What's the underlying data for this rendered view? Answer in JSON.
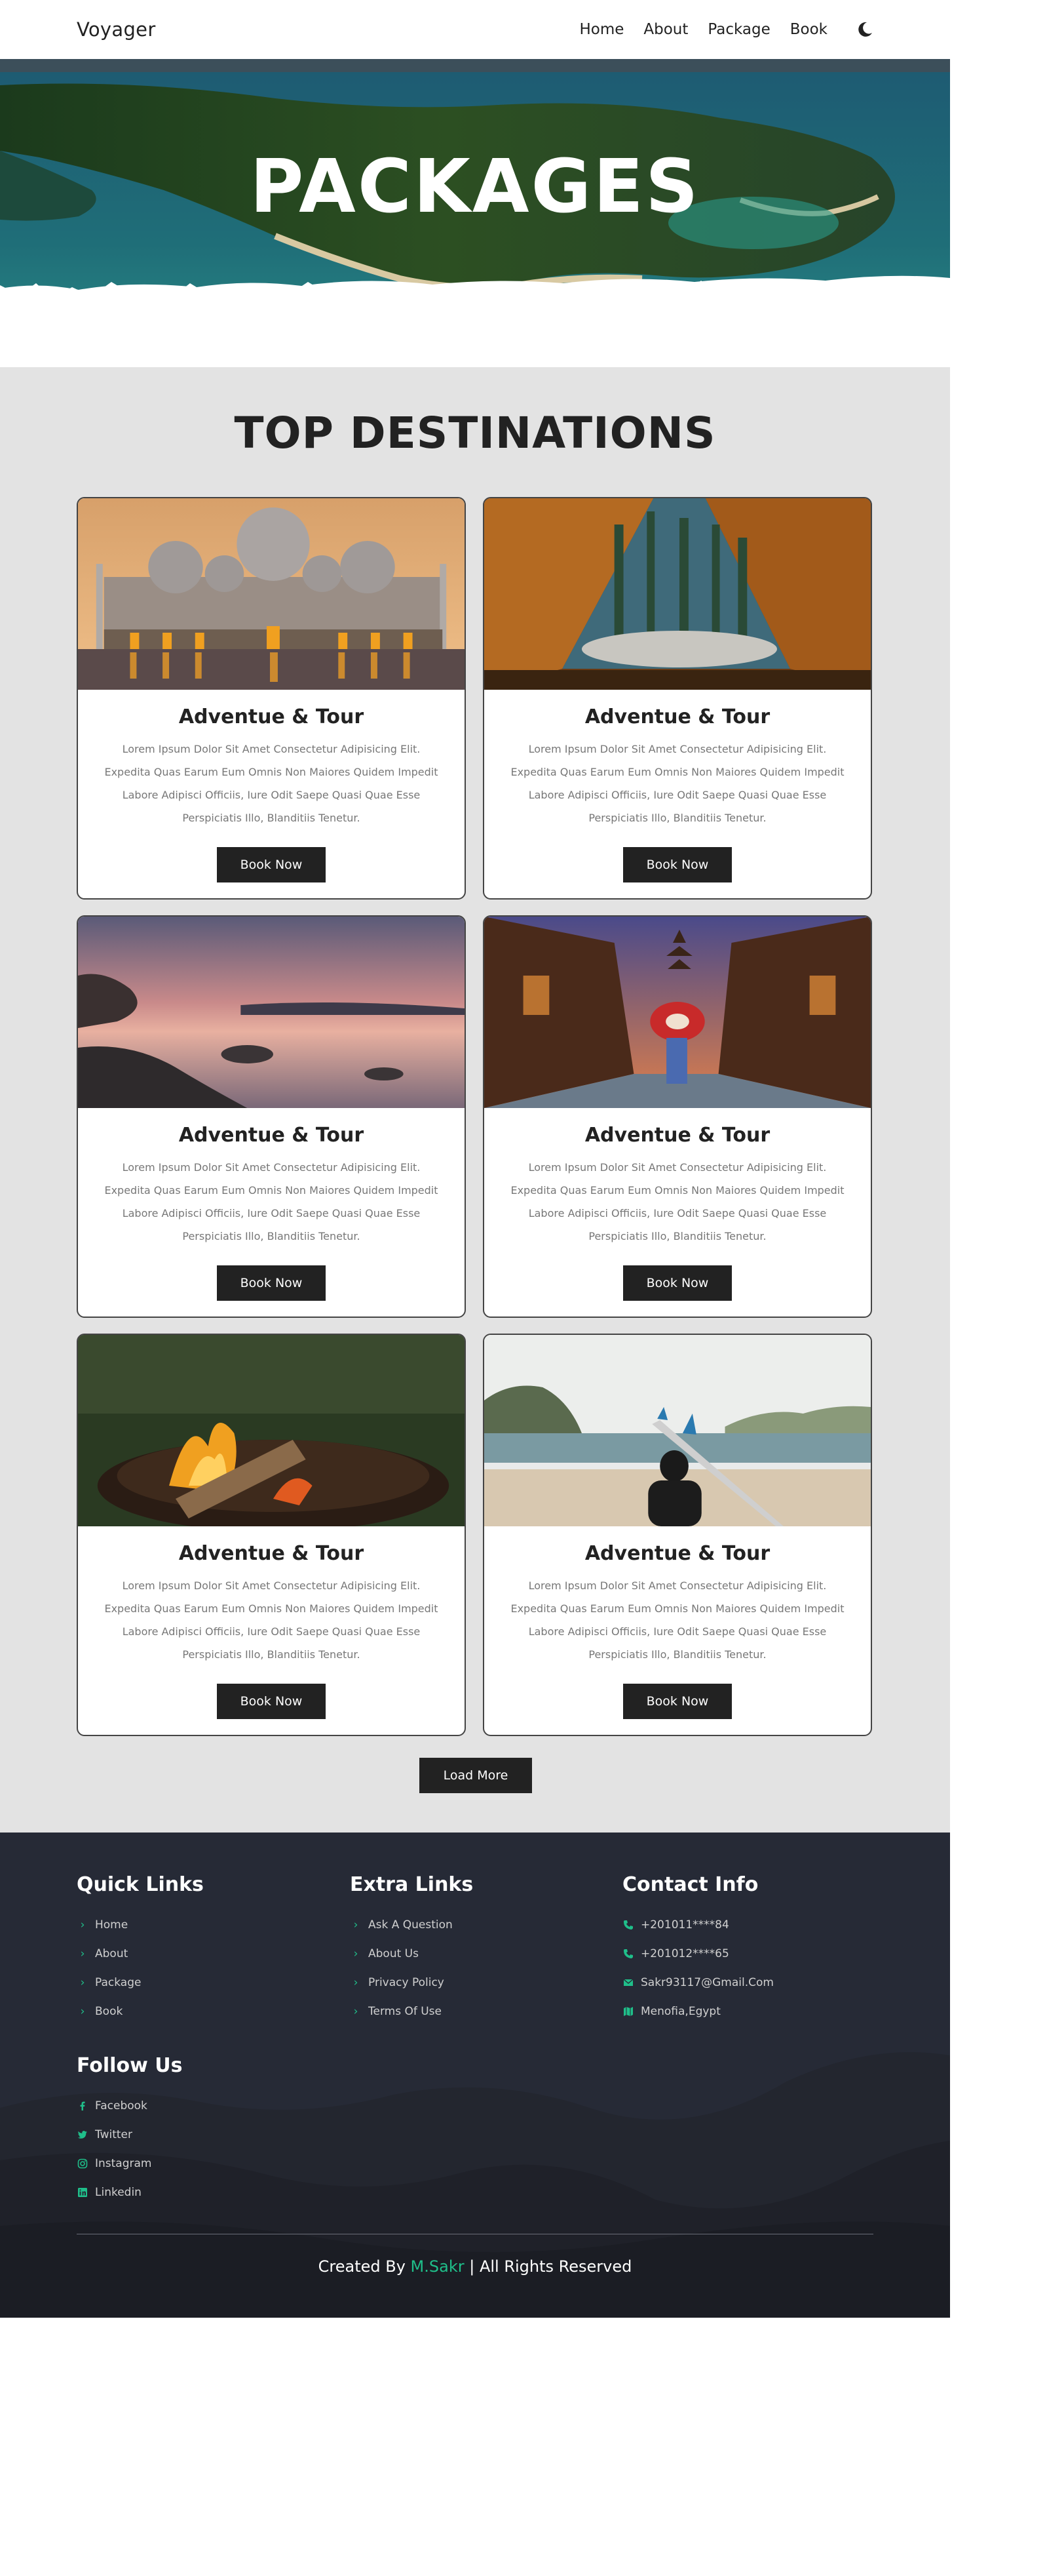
{
  "nav": {
    "logo": "Voyager",
    "links": [
      "Home",
      "About",
      "Package",
      "Book"
    ]
  },
  "hero": {
    "title": "PACKAGES"
  },
  "destinations": {
    "title": "TOP DESTINATIONS",
    "cards": [
      {
        "title": "Adventue & Tour",
        "text": "Lorem Ipsum Dolor Sit Amet Consectetur Adipisicing Elit. Expedita Quas Earum Eum Omnis Non Maiores Quidem Impedit Labore Adipisci Officiis, Iure Odit Saepe Quasi Quae Esse Perspiciatis Illo, Blanditiis Tenetur.",
        "button": "Book Now"
      },
      {
        "title": "Adventue & Tour",
        "text": "Lorem Ipsum Dolor Sit Amet Consectetur Adipisicing Elit. Expedita Quas Earum Eum Omnis Non Maiores Quidem Impedit Labore Adipisci Officiis, Iure Odit Saepe Quasi Quae Esse Perspiciatis Illo, Blanditiis Tenetur.",
        "button": "Book Now"
      },
      {
        "title": "Adventue & Tour",
        "text": "Lorem Ipsum Dolor Sit Amet Consectetur Adipisicing Elit. Expedita Quas Earum Eum Omnis Non Maiores Quidem Impedit Labore Adipisci Officiis, Iure Odit Saepe Quasi Quae Esse Perspiciatis Illo, Blanditiis Tenetur.",
        "button": "Book Now"
      },
      {
        "title": "Adventue & Tour",
        "text": "Lorem Ipsum Dolor Sit Amet Consectetur Adipisicing Elit. Expedita Quas Earum Eum Omnis Non Maiores Quidem Impedit Labore Adipisci Officiis, Iure Odit Saepe Quasi Quae Esse Perspiciatis Illo, Blanditiis Tenetur.",
        "button": "Book Now"
      },
      {
        "title": "Adventue & Tour",
        "text": "Lorem Ipsum Dolor Sit Amet Consectetur Adipisicing Elit. Expedita Quas Earum Eum Omnis Non Maiores Quidem Impedit Labore Adipisci Officiis, Iure Odit Saepe Quasi Quae Esse Perspiciatis Illo, Blanditiis Tenetur.",
        "button": "Book Now"
      },
      {
        "title": "Adventue & Tour",
        "text": "Lorem Ipsum Dolor Sit Amet Consectetur Adipisicing Elit. Expedita Quas Earum Eum Omnis Non Maiores Quidem Impedit Labore Adipisci Officiis, Iure Odit Saepe Quasi Quae Esse Perspiciatis Illo, Blanditiis Tenetur.",
        "button": "Book Now"
      }
    ],
    "load_more": "Load More"
  },
  "footer": {
    "quick_links": {
      "title": "Quick Links",
      "items": [
        "Home",
        "About",
        "Package",
        "Book"
      ]
    },
    "extra_links": {
      "title": "Extra Links",
      "items": [
        "Ask A Question",
        "About Us",
        "Privacy Policy",
        "Terms Of Use"
      ]
    },
    "contact": {
      "title": "Contact Info",
      "phone1": "+201011****84",
      "phone2": "+201012****65",
      "email": "Sakr93117@Gmail.Com",
      "location": "Menofia,Egypt"
    },
    "follow": {
      "title": "Follow Us",
      "items": [
        "Facebook",
        "Twitter",
        "Instagram",
        "Linkedin"
      ]
    },
    "credit_prefix": "Created By",
    "credit_name": "M.Sakr",
    "credit_suffix": "| All Rights Reserved"
  },
  "colors": {
    "accent": "#1fbf8a",
    "dark": "#222222",
    "footer_bg": "#252934",
    "section_bg": "#e3e3e3"
  },
  "icons": [
    "moon-icon",
    "chevron-right-icon",
    "phone-icon",
    "envelope-icon",
    "map-icon",
    "facebook-icon",
    "twitter-icon",
    "instagram-icon",
    "linkedin-icon"
  ]
}
